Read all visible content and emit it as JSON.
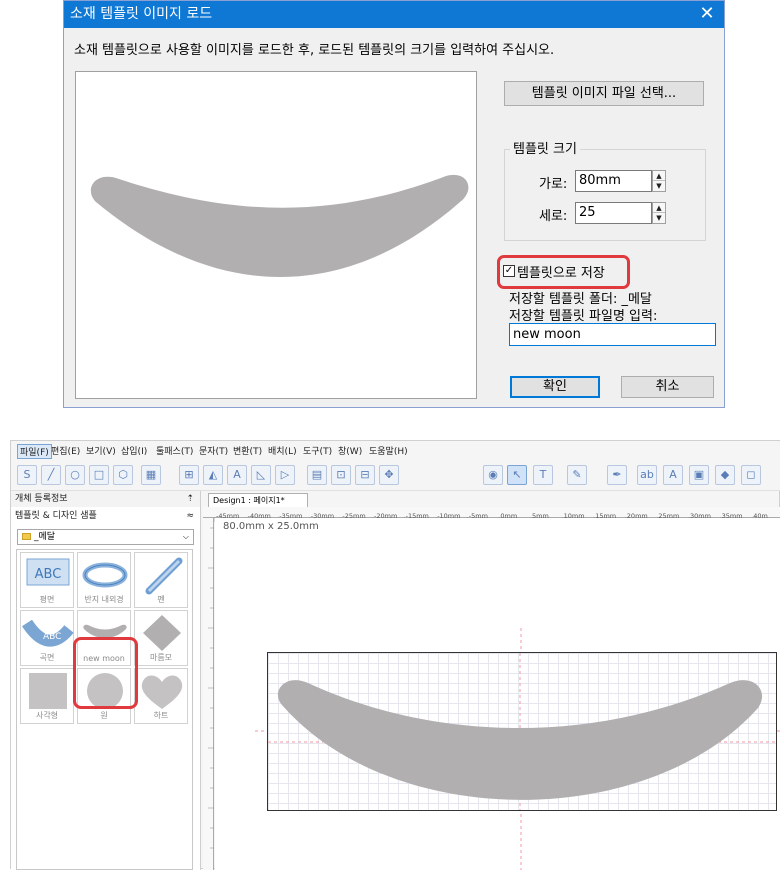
{
  "dialog": {
    "title": "소재 템플릿 이미지 로드",
    "close_glyph": "✕",
    "instruction": "소재 템플릿으로 사용할 이미지를 로드한 후, 로드된 템플릿의 크기를 입력하여 주십시오.",
    "select_file_button": "템플릿 이미지 파일 선택...",
    "size_group_label": "템플릿 크기",
    "width_label": "가로:",
    "width_value": "80mm",
    "height_label": "세로:",
    "height_value": "25",
    "save_checkbox_label": "템플릿으로 저장",
    "save_checked": true,
    "save_folder_label": "저장할 템플릿 폴더: _메달",
    "filename_label": "저장할 템플릿 파일명 입력:",
    "filename_value": "new moon",
    "ok_button": "확인",
    "cancel_button": "취소",
    "highlight_color": "#e0393e",
    "titlebar_color": "#0e78d4"
  },
  "app": {
    "menu": [
      "파일(F)",
      "편집(E)",
      "보기(V)",
      "삽입(I)",
      "툴패스(T)",
      "문자(T)",
      "변환(T)",
      "배치(L)",
      "도구(T)",
      "창(W)",
      "도움말(H)"
    ],
    "toolbar_icons": [
      "svg-import-icon",
      "line-icon",
      "circle-icon",
      "rectangle-icon",
      "polygon-icon",
      "qrcode-icon",
      "table-icon",
      "shape-icon",
      "text-icon",
      "triangle-icon",
      "select-icon",
      "text-tool-icon",
      "brush-icon",
      "pen-icon",
      "image-icon",
      "fill-icon"
    ],
    "panel_title": "개체 등록정보",
    "pin_glyph": "⇡",
    "section_title": "템플릿 & 디자인 샘플",
    "collapse_glyph": "≈",
    "folder_selected": "_메달",
    "thumbnails": [
      {
        "label": "평면",
        "icon": "flat-abc-icon"
      },
      {
        "label": "반지 내외경",
        "icon": "ring-icon"
      },
      {
        "label": "펜",
        "icon": "pen-icon"
      },
      {
        "label": "곡면",
        "icon": "curved-abc-icon"
      },
      {
        "label": "new moon",
        "icon": "new-moon-icon"
      },
      {
        "label": "마름모",
        "icon": "diamond-icon"
      },
      {
        "label": "사각형",
        "icon": "square-icon"
      },
      {
        "label": "원",
        "icon": "circle-icon"
      },
      {
        "label": "하트",
        "icon": "heart-icon"
      }
    ],
    "doc_tab": "Design1 : 페이지1*",
    "ruler_labels": [
      "-45mm",
      "-40mm",
      "-35mm",
      "-30mm",
      "-25mm",
      "-20mm",
      "-15mm",
      "-10mm",
      "-5mm",
      "0mm",
      "5mm",
      "10mm",
      "15mm",
      "20mm",
      "25mm",
      "30mm",
      "35mm",
      "40m"
    ],
    "size_label": "80.0mm x 25.0mm",
    "shape_color": "#b2afb1"
  }
}
